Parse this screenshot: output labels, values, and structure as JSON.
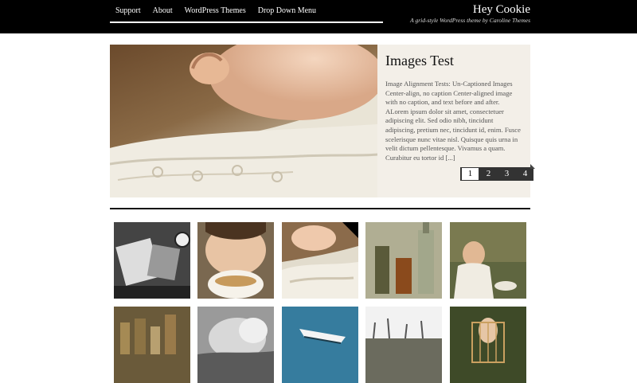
{
  "nav": {
    "items": [
      {
        "label": "Support"
      },
      {
        "label": "About"
      },
      {
        "label": "WordPress Themes"
      },
      {
        "label": "Drop Down Menu"
      }
    ]
  },
  "site": {
    "title": "Hey Cookie",
    "tagline": "A grid-style WordPress theme by Caroline Themes"
  },
  "feature": {
    "title": "Images Test",
    "excerpt": "Image Alignment Tests: Un-Captioned Images Center-align, no caption Center-aligned image with no caption, and text before and after. ALorem ipsum dolor sit amet, consectetuer adipiscing elit. Sed odio nibh, tincidunt adipiscing, pretium nec, tincidunt id, enim. Fusce scelerisque nunc vitae nisl. Quisque quis urna in velit dictum pellentesque. Vivamus a quam. Curabitur eu tortor id [...]",
    "pager": [
      "1",
      "2",
      "3",
      "4"
    ],
    "active_page": "1"
  },
  "colors": {
    "header_bg": "#000000",
    "text": "#555555",
    "pager_bg": "#333333"
  }
}
